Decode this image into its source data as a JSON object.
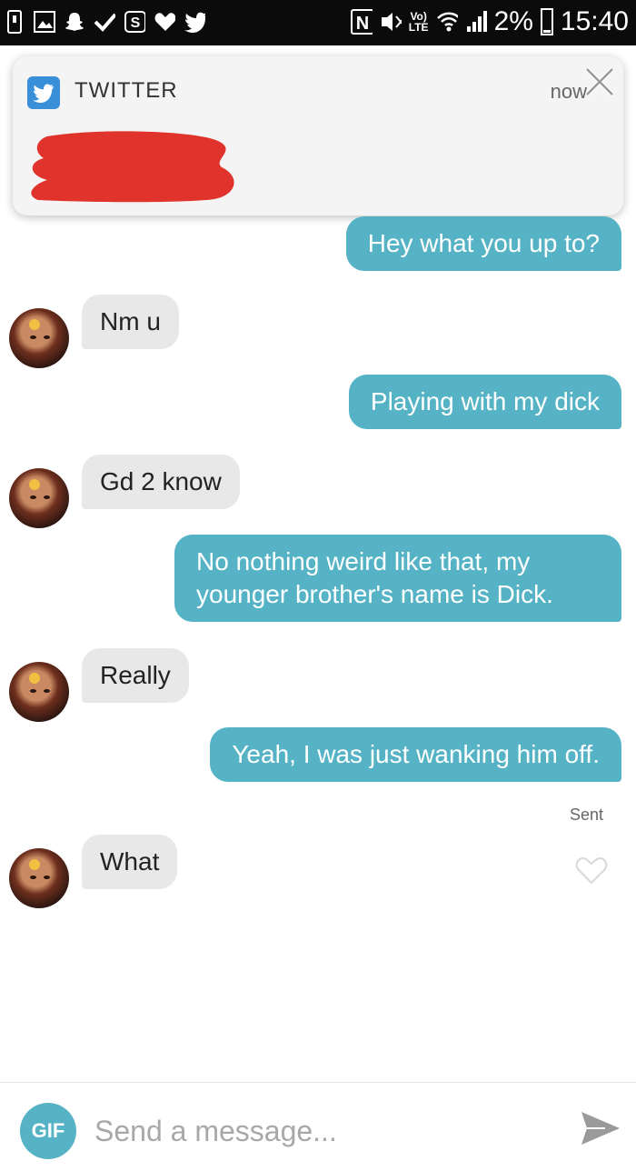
{
  "status_bar": {
    "network_label": "Vo)\nLTE",
    "battery": "2%",
    "time": "15:40"
  },
  "notification": {
    "app_name": "TWITTER",
    "time": "now"
  },
  "messages": [
    {
      "from": "me",
      "text": "Hey what you up to?"
    },
    {
      "from": "them",
      "text": "Nm u"
    },
    {
      "from": "me",
      "text": "Playing with my dick"
    },
    {
      "from": "them",
      "text": "Gd 2 know"
    },
    {
      "from": "me",
      "text": "No nothing weird like that, my younger brother's name is Dick."
    },
    {
      "from": "them",
      "text": "Really"
    },
    {
      "from": "me",
      "text": "Yeah, I was just wanking him off."
    },
    {
      "from": "them",
      "text": "What"
    }
  ],
  "sent_label": "Sent",
  "composer": {
    "gif_label": "GIF",
    "placeholder": "Send a message..."
  },
  "colors": {
    "outgoing_bubble": "#55b3c5",
    "incoming_bubble": "#e8e8e8",
    "twitter_blue": "#3a8fd9",
    "redaction": "#e0332b"
  }
}
